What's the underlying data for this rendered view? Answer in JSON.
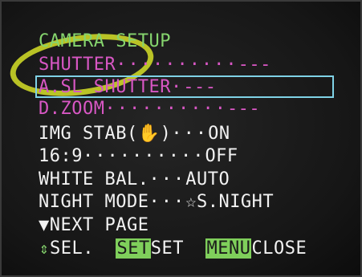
{
  "menu": {
    "title": "CAMERA SETUP",
    "items": [
      {
        "label": "SHUTTER",
        "dots": "··········",
        "value": "---"
      },
      {
        "label": "A.SL SHUTTER",
        "dots": "·",
        "value": "---"
      },
      {
        "label": "D.ZOOM",
        "dots": "··········",
        "value": "---"
      },
      {
        "label": "IMG STAB",
        "dots": "···",
        "value": "ON",
        "icon": "hand-shake-icon"
      },
      {
        "label": "16:9",
        "dots": "··········",
        "value": "OFF"
      },
      {
        "label": "WHITE BAL.",
        "dots": "···",
        "value": "AUTO"
      },
      {
        "label": "NIGHT MODE",
        "dots": "···",
        "value": "S.NIGHT",
        "icon": "star-night-icon"
      }
    ],
    "next_page": "NEXT PAGE"
  },
  "footer": {
    "sel_label": "SEL.",
    "set_key": "SET",
    "set_label": "SET",
    "menu_key": "MENU",
    "close_label": "CLOSE"
  },
  "colors": {
    "title": "#86d56e",
    "inactive": "#d857c4",
    "active": "#f2f2f2",
    "selection": "#7fd2e6",
    "annotation": "#d6e028"
  }
}
